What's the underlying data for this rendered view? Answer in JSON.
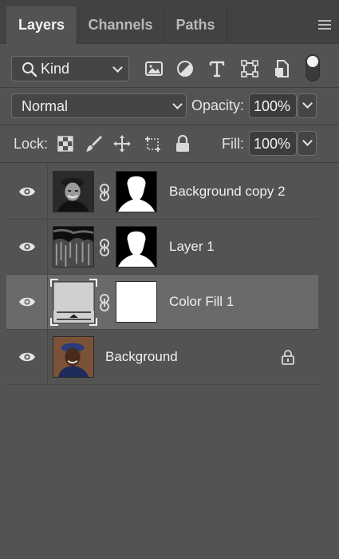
{
  "tabs": [
    {
      "label": "Layers",
      "active": true
    },
    {
      "label": "Channels",
      "active": false
    },
    {
      "label": "Paths",
      "active": false
    }
  ],
  "filter": {
    "kind_label": "Kind",
    "filter_icons": [
      "image-filter-icon",
      "adjustment-filter-icon",
      "type-filter-icon",
      "shape-filter-icon",
      "smart-object-filter-icon"
    ],
    "filter_toggle_on": true
  },
  "blend": {
    "mode": "Normal",
    "opacity_label": "Opacity:",
    "opacity_value": "100%"
  },
  "lock": {
    "label": "Lock:",
    "icons": [
      "lock-transparent-pixels-icon",
      "lock-image-pixels-icon",
      "lock-position-icon",
      "lock-artboard-icon",
      "lock-all-icon"
    ],
    "fill_label": "Fill:",
    "fill_value": "100%"
  },
  "layers": [
    {
      "name": "Background copy 2",
      "visible": true,
      "selected": false,
      "thumb": "bw-portrait",
      "mask": "figure-silhouette",
      "linked": true
    },
    {
      "name": "Layer 1",
      "visible": true,
      "selected": false,
      "thumb": "dark-texture",
      "mask": "figure-silhouette",
      "linked": true
    },
    {
      "name": "Color Fill 1",
      "visible": true,
      "selected": true,
      "thumb": "fill-swatch",
      "mask": "white",
      "linked": true
    },
    {
      "name": "Background",
      "visible": true,
      "selected": false,
      "thumb": "color-portrait",
      "locked": true
    }
  ],
  "colors": {
    "panel_bg": "#535353",
    "tabbar_bg": "#424242",
    "selected_row": "#6a6a6a",
    "text": "#f0f0f0"
  }
}
